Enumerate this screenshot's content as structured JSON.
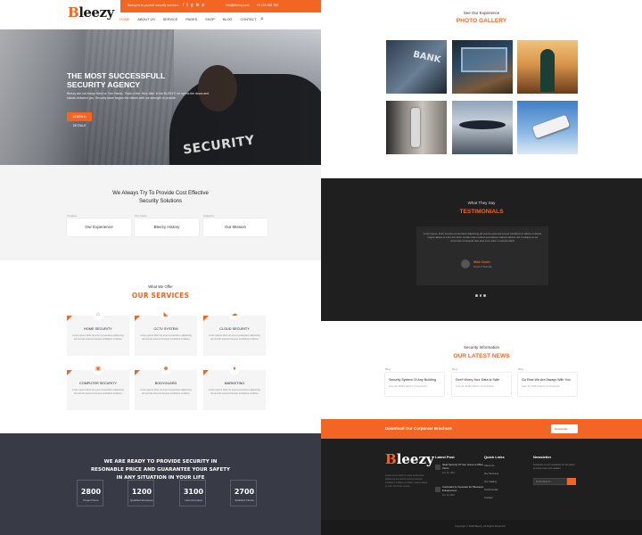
{
  "header": {
    "logo_first": "B",
    "logo_rest": "leezy",
    "slogan": "Bleezy is to provide security services",
    "social": [
      "f",
      "t",
      "g",
      "in",
      "p"
    ],
    "phone": "info@bleezy.com",
    "phone_icon": "phone-icon",
    "email": "+0 123 456 789",
    "email_icon": "mail-icon",
    "nav": [
      "Home",
      "About Us",
      "Service",
      "Pages",
      "Shop",
      "Blog",
      "Contact"
    ],
    "search_icon": "search-icon"
  },
  "hero": {
    "title": "The Most Successfull Security Agency",
    "text": "Bleezy are not Kanye West or Tom Hanks. Think of the ‘Nice Man’ in the BLEEZY, he opens the doors and stands between you. Security team begins the clients with our strength to provide.",
    "button": "Learn a Details",
    "image_word": "SECURITY"
  },
  "provide": {
    "title": "We Always Try To Provide Cost Effective Security Solutions",
    "cards": [
      {
        "tag": "Creative",
        "label": "Our Experience"
      },
      {
        "tag": "Our Vision",
        "label": "Bleezy History"
      },
      {
        "tag": "Analytics",
        "label": "Our Mission"
      }
    ]
  },
  "services": {
    "subtitle": "What We Offer",
    "title": "Our Services",
    "items": [
      {
        "icon": "home-icon",
        "glyph": "⌂",
        "title": "Home Security",
        "desc": "Lorem ipsum dolor sit amet consectetur adipiscing elit sed do eiusmod tempor incididunt ut labore"
      },
      {
        "icon": "cctv-icon",
        "glyph": "◣",
        "title": "CCTV System",
        "desc": "Lorem ipsum dolor sit amet consectetur adipiscing elit sed do eiusmod tempor incididunt ut labore"
      },
      {
        "icon": "cloud-icon",
        "glyph": "☁",
        "title": "Cloud Security",
        "desc": "Lorem ipsum dolor sit amet consectetur adipiscing elit sed do eiusmod tempor incididunt ut labore"
      },
      {
        "icon": "computer-icon",
        "glyph": "▣",
        "title": "Computer Security",
        "desc": "Lorem ipsum dolor sit amet consectetur adipiscing elit sed do eiusmod tempor incididunt ut labore"
      },
      {
        "icon": "bodyguard-icon",
        "glyph": "☻",
        "title": "Bodyguard",
        "desc": "Lorem ipsum dolor sit amet consectetur adipiscing elit sed do eiusmod tempor incididunt ut labore"
      },
      {
        "icon": "marketing-icon",
        "glyph": "♦",
        "title": "Marketing",
        "desc": "Lorem ipsum dolor sit amet consectetur adipiscing elit sed do eiusmod tempor incididunt ut labore"
      }
    ]
  },
  "ready": {
    "title": "We Are Ready To Provide Security In Resonable Price And Guarantee Your Safety In Any Situation In Your Life",
    "stats": [
      {
        "num": "2800",
        "label": "Project Done"
      },
      {
        "num": "1200",
        "label": "Qualified Employee"
      },
      {
        "num": "3100",
        "label": "Host Accepted"
      },
      {
        "num": "2700",
        "label": "Satisfied Clients"
      }
    ]
  },
  "gallery": {
    "subtitle": "See Our Experience",
    "title": "Photo Gallery"
  },
  "testimonials": {
    "subtitle": "What They Say",
    "title": "Testimonials",
    "quote": "Lorem ipsum dolor sit amet consectetur adipiscing elit sed do eiusmod tempor incididunt ut labore et dolore magna aliqua ut enim ad minim veniam quis nostrud exercitation ullamco laboris nisi ut aliquip ex ea commodo consequat duis aute irure dolor in reprehenderit",
    "name": "Mike Coder",
    "role": "Head of Security"
  },
  "news": {
    "subtitle": "Security Information",
    "title": "Our Latest News",
    "items": [
      {
        "tag": "Blog",
        "title": "Security System Of Any Building",
        "meta": "June 10, 2018  |  Admin  |  3 Comments"
      },
      {
        "tag": "Blog",
        "title": "Don't Worry Your Data Is Safe",
        "meta": "June 10, 2018  |  Admin  |  3 Comments"
      },
      {
        "tag": "Blog",
        "title": "Go Rest We Are Always With You",
        "meta": "June 10, 2018  |  Admin  |  3 Comments"
      }
    ]
  },
  "footer": {
    "band_text": "Download Our Corporate Brochure",
    "band_button": "Download",
    "logo_first": "B",
    "logo_rest": "leezy",
    "desc": "Lorem ipsum dolor sit amet consectetur adipiscing elit sed do eiusmod tempor incididunt ut labore et dolore magna aliqua ut enim ad minim veniam",
    "latest_post_heading": "Latest Post",
    "posts": [
      {
        "title": "Ideal Security Of Your Home & Office Client",
        "date": "Jun 10, 2018"
      },
      {
        "title": "Consultant Is Important For Business Entrepreneur",
        "date": "Jun 10, 2018"
      }
    ],
    "quick_links_heading": "Quick Links",
    "quick_links": [
      "About Us",
      "Our Services",
      "Our Gallery",
      "Testimonials",
      "Contact"
    ],
    "newsletter_heading": "Newsletter",
    "newsletter_text": "Subscribe to our newsletter for the latest security news and updates",
    "newsletter_placeholder": "Email Address",
    "copyright": "Copyright © 2018 Bleezy. All Rights Reserved"
  }
}
